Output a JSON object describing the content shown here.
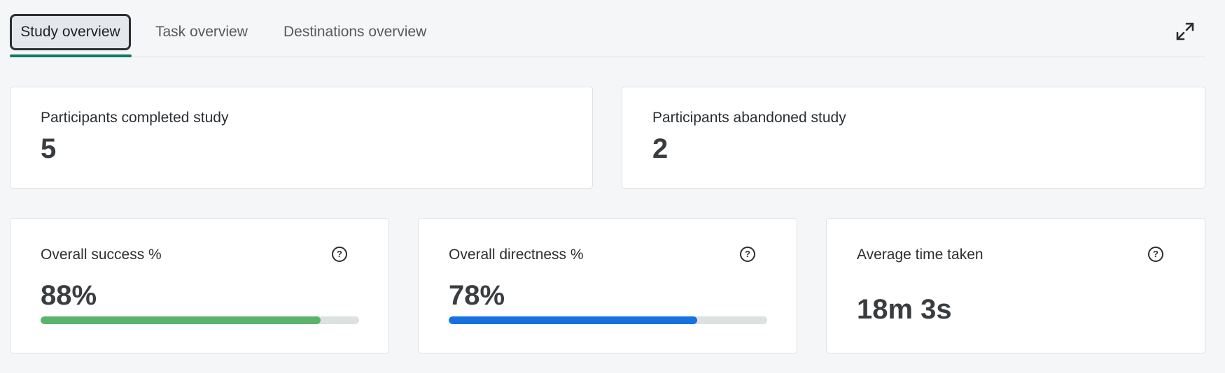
{
  "tabs": [
    {
      "label": "Study overview",
      "active": true
    },
    {
      "label": "Task overview",
      "active": false
    },
    {
      "label": "Destinations overview",
      "active": false
    }
  ],
  "toolbar": {
    "expand_icon": "expand-icon"
  },
  "completed": {
    "label": "Participants completed study",
    "value": "5"
  },
  "abandoned": {
    "label": "Participants abandoned study",
    "value": "2"
  },
  "success": {
    "label": "Overall success %",
    "value": "88%",
    "fraction": 0.88,
    "color": "#5cb36c",
    "help_icon": "help-icon"
  },
  "directness": {
    "label": "Overall directness %",
    "value": "78%",
    "fraction": 0.78,
    "color": "#1672e0",
    "help_icon": "help-icon"
  },
  "time": {
    "label": "Average time taken",
    "value": "18m 3s",
    "help_icon": "help-icon"
  },
  "colors": {
    "accent": "#107a63",
    "track": "#dde1e2"
  }
}
